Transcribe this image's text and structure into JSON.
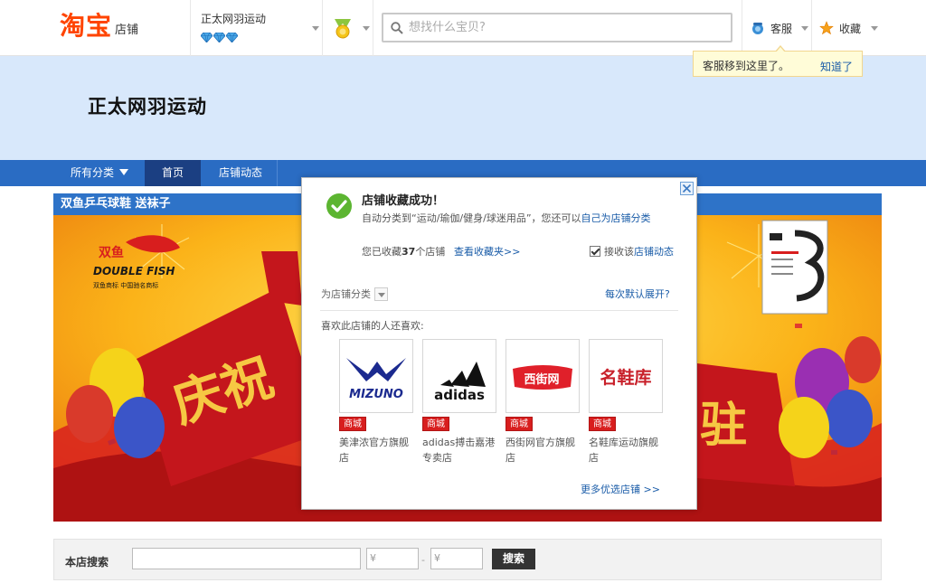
{
  "header": {
    "logo_main": "淘宝",
    "logo_sub": "店铺",
    "shop_name": "正太网羽运动",
    "search_placeholder": "想找什么宝贝?",
    "service_label": "客服",
    "favorite_label": "收藏"
  },
  "tooltip": {
    "text": "客服移到这里了。",
    "link": "知道了"
  },
  "banner": {
    "shop_title": "正太网羽运动"
  },
  "nav": {
    "all_categories": "所有分类",
    "home": "首页",
    "shop_news": "店铺动态"
  },
  "promo": {
    "heading": "双鱼乒乓球鞋 送袜子",
    "brand_cn": "双鱼",
    "brand_en": "DOUBLE FISH",
    "brand_tagline": "双鱼商标 中国驰名商标",
    "celebrate_left": "庆祝",
    "celebrate_right": "驻"
  },
  "dialog": {
    "title": "店铺收藏成功！",
    "desc_prefix": "自动分类到“运动/瑜伽/健身/球迷用品”，您还可以",
    "desc_link": "自己为店铺分类",
    "count_prefix": "您已收藏",
    "count_value": "37",
    "count_suffix": "个店铺",
    "view_favorites": "查看收藏夹>>",
    "receive_prefix": "接收该",
    "receive_link": "店铺动态",
    "category_label": "为店铺分类",
    "default_expand": "每次默认展开?",
    "also_like": "喜欢此店铺的人还喜欢:",
    "mall_badge": "商城",
    "shops": [
      {
        "name": "美津浓官方旗舰店",
        "logo": "MIZUNO"
      },
      {
        "name": "adidas搏击嘉港专卖店",
        "logo": "adidas"
      },
      {
        "name": "西街网官方旗舰店",
        "logo": "西街网"
      },
      {
        "name": "名鞋库运动旗舰店",
        "logo": "名鞋库"
      }
    ],
    "more_shops": "更多优选店铺 >>"
  },
  "store_search": {
    "label": "本店搜索",
    "price_from": "¥",
    "price_to": "¥",
    "dash": "-",
    "button": "搜索"
  },
  "colors": {
    "taobao_orange": "#ff4400",
    "nav_blue": "#2a6cc3",
    "banner_bg": "#d8e8fb",
    "link_blue": "#1a5ca8"
  }
}
